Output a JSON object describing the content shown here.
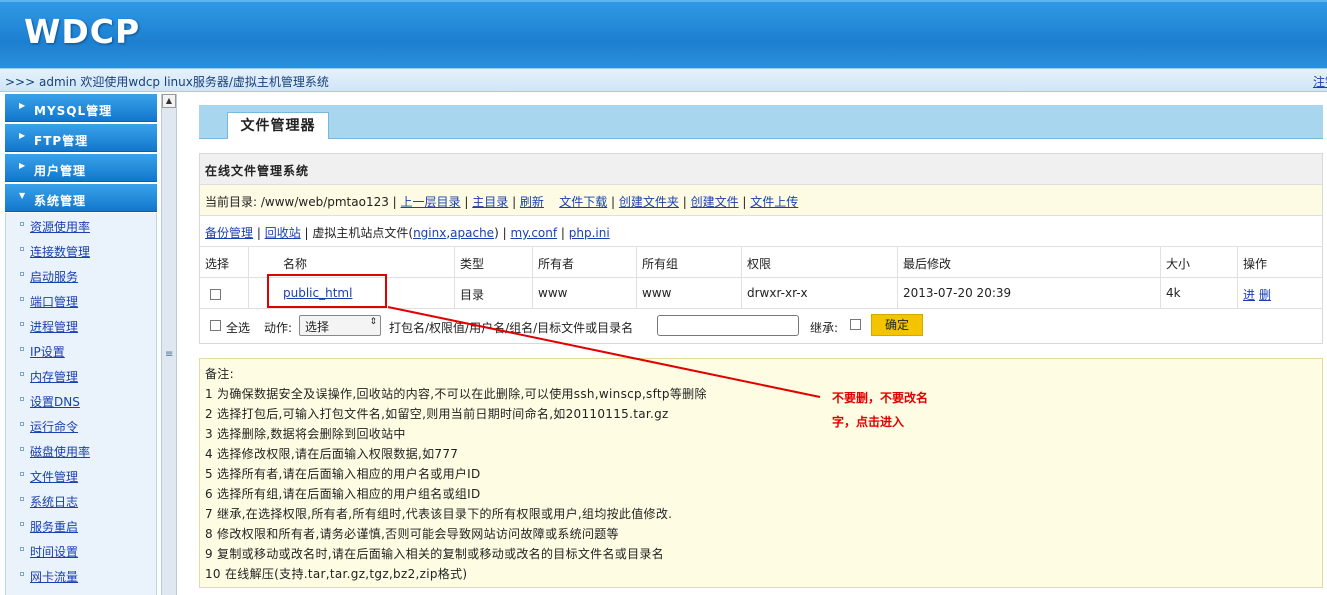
{
  "header": {
    "logo": "WDCP"
  },
  "topbar": {
    "welcome": ">>> admin 欢迎使用wdcp linux服务器/虚拟主机管理系统",
    "logout": "注销"
  },
  "sidebar": {
    "groups": [
      {
        "label": "MYSQL管理"
      },
      {
        "label": "FTP管理"
      },
      {
        "label": "用户管理"
      },
      {
        "label": "系统管理"
      }
    ],
    "items": [
      {
        "label": "资源使用率"
      },
      {
        "label": "连接数管理"
      },
      {
        "label": "启动服务"
      },
      {
        "label": "端口管理"
      },
      {
        "label": "进程管理"
      },
      {
        "label": "IP设置"
      },
      {
        "label": "内存管理"
      },
      {
        "label": "设置DNS"
      },
      {
        "label": "运行命令"
      },
      {
        "label": "磁盘使用率"
      },
      {
        "label": "文件管理"
      },
      {
        "label": "系统日志"
      },
      {
        "label": "服务重启"
      },
      {
        "label": "时间设置"
      },
      {
        "label": "网卡流量"
      }
    ]
  },
  "main": {
    "tab": "文件管理器",
    "system_title": "在线文件管理系统",
    "current_dir_label": "当前目录: /www/web/pmtao123 |",
    "dir_links": {
      "up": "上一层目录",
      "home": "主目录",
      "refresh": "刷新",
      "download": "文件下载",
      "mkdir": "创建文件夹",
      "mkfile": "创建文件",
      "upload": "文件上传"
    },
    "links": {
      "backup": "备份管理",
      "recycle": "回收站",
      "vhost_text": "虚拟主机站点文件(",
      "nginx": "nginx",
      "apache": "apache",
      "close": ")",
      "myconf": "my.conf",
      "phpini": "php.ini"
    },
    "columns": {
      "select": "选择",
      "name": "名称",
      "type": "类型",
      "owner": "所有者",
      "group": "所有组",
      "perm": "权限",
      "modified": "最后修改",
      "size": "大小",
      "ops": "操作"
    },
    "file": {
      "name": "public_html",
      "type": "目录",
      "owner": "www",
      "group": "www",
      "perm": "drwxr-xr-x",
      "modified": "2013-07-20 20:39",
      "size": "4k",
      "op_enter": "进",
      "op_delete": "删"
    },
    "actions": {
      "select_all": "全选",
      "action_label": "动作:",
      "action_value": "选择",
      "target_label": "打包名/权限值/用户名/组名/目标文件或目录名",
      "inherit_label": "继承:",
      "confirm": "确定"
    },
    "notes": [
      "备注:",
      "1 为确保数据安全及误操作,回收站的内容,不可以在此删除,可以使用ssh,winscp,sftp等删除",
      "2 选择打包后,可输入打包文件名,如留空,则用当前日期时间命名,如20110115.tar.gz",
      "3 选择删除,数据将会删除到回收站中",
      "4 选择修改权限,请在后面输入权限数据,如777",
      "5 选择所有者,请在后面输入相应的用户名或用户ID",
      "6 选择所有组,请在后面输入相应的用户组名或组ID",
      "7 继承,在选择权限,所有者,所有组时,代表该目录下的所有权限或用户,组均按此值修改.",
      "8 修改权限和所有者,请务必谨慎,否则可能会导致网站访问故障或系统问题等",
      "9 复制或移动或改名时,请在后面输入相关的复制或移动或改名的目标文件名或目录名",
      "10 在线解压(支持.tar,tar.gz,tgz,bz2,zip格式)"
    ]
  },
  "annotation": {
    "line1": "不要删，不要改名",
    "line2": "字，点击进入",
    "color": "#e00000"
  }
}
